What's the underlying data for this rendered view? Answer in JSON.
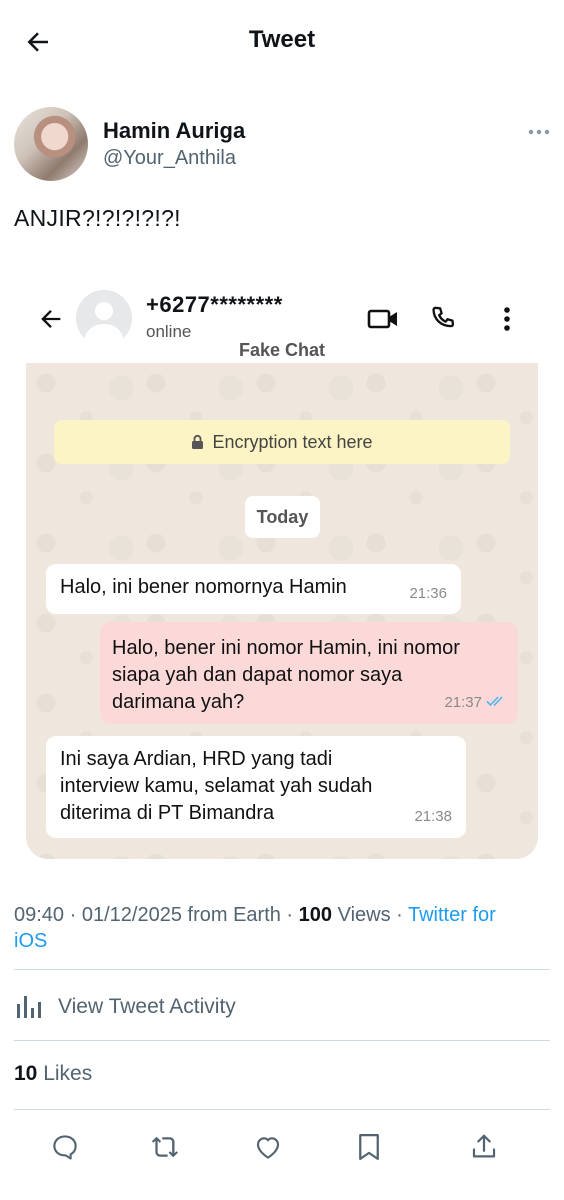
{
  "header": {
    "title": "Tweet",
    "back_icon": "arrow-left-icon"
  },
  "author": {
    "name": "Hamin Auriga",
    "handle": "@Your_Anthila",
    "more_icon": "more-horizontal-icon"
  },
  "tweet": {
    "text": "ANJIR?!?!?!?!?!"
  },
  "chat_screenshot": {
    "contact_number": "+6277********",
    "contact_status": "online",
    "watermark": "Fake Chat",
    "icons": [
      "arrow-left-icon",
      "video-call-icon",
      "phone-icon",
      "more-vertical-icon"
    ],
    "encryption_text": "Encryption text here",
    "date_pill": "Today",
    "messages": [
      {
        "direction": "incoming",
        "lines": [
          "Halo, ini bener nomornya Hamin"
        ],
        "time": "21:36"
      },
      {
        "direction": "outgoing",
        "lines": [
          "Halo, bener ini nomor Hamin, ini nomor",
          "siapa yah dan dapat nomor saya",
          "darimana yah?"
        ],
        "time": "21:37",
        "read": true
      },
      {
        "direction": "incoming",
        "lines": [
          "Ini saya Ardian, HRD yang tadi",
          "interview kamu, selamat yah sudah",
          "diterima di PT Bimandra"
        ],
        "time": "21:38"
      }
    ],
    "colors": {
      "panel_bg": "#efe7de",
      "encryption_bg": "#fcf4c4",
      "outgoing_bubble": "#fcd9d9",
      "read_ticks": "#4fb6ec"
    }
  },
  "meta": {
    "time": "09:40",
    "sep1": " · ",
    "date": "01/12/2025",
    "from": " from Earth · ",
    "views_count": "100",
    "views_label": " Views · ",
    "client_line1": "Twitter for",
    "client_line2": "iOS"
  },
  "activity": {
    "label": "View Tweet Activity",
    "icon": "bar-chart-icon"
  },
  "likes": {
    "count": "10",
    "label": " Likes"
  },
  "actions": [
    "reply-icon",
    "retweet-icon",
    "like-icon",
    "bookmark-icon",
    "share-icon"
  ],
  "colors": {
    "link": "#1d9bf0",
    "secondary_text": "#536471",
    "divider": "#cfd9de"
  }
}
